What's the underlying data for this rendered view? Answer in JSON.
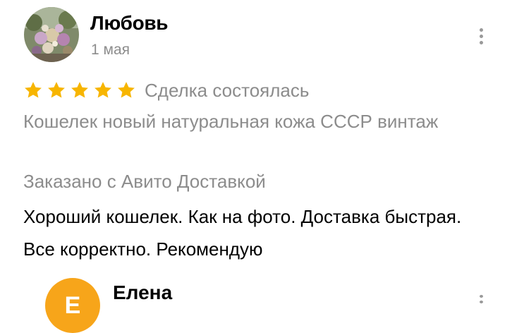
{
  "review": {
    "author": "Любовь",
    "date": "1 мая",
    "rating": 5,
    "rating_max": 5,
    "star_color": "#f7b500",
    "deal_status": "Сделка состоялась",
    "item_title": "Кошелек новый натуральная кожа СССР винтаж",
    "delivery_note": "Заказано с Авито Доставкой",
    "text": "Хороший кошелек. Как на фото. Доставка быстрая. Все корректно. Рекомендую",
    "avatar_icon": "flowers-photo-avatar",
    "menu_icon": "more-vertical-icon"
  },
  "next_review": {
    "author": "Елена",
    "avatar_initial": "Е",
    "avatar_color": "#f7a51a",
    "menu_icon": "more-vertical-icon"
  }
}
